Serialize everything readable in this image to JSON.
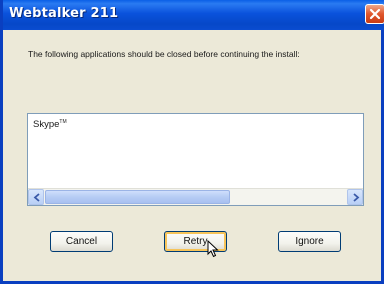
{
  "window": {
    "title": "Webtalker 211"
  },
  "icons": {
    "close": "close-icon",
    "scroll_left": "arrow-left-icon",
    "scroll_right": "arrow-right-icon",
    "cursor": "mouse-pointer-icon"
  },
  "message": {
    "text": "The following applications should be closed before continuing the install:"
  },
  "applications": {
    "items": [
      {
        "name": "Skype",
        "mark": "TM"
      }
    ]
  },
  "buttons": {
    "cancel": "Cancel",
    "retry": "Retry",
    "ignore": "Ignore"
  },
  "colors": {
    "titlebar": "#0a52dc",
    "dialog_bg": "#ece9d8",
    "close_button": "#e0562c",
    "focused_button_highlight": "#f6c45a"
  }
}
